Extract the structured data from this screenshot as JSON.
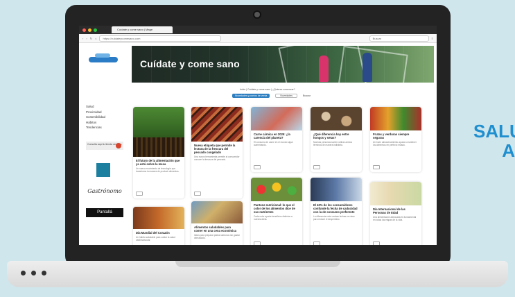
{
  "side_text": {
    "line1": "SALU",
    "line2": "A"
  },
  "browser": {
    "tab_title": "Cuídate y come sano | Mage",
    "url": "https://cuidateycomesano.com",
    "search_placeholder": "Buscar"
  },
  "sidebar": {
    "logo_text": "CLL",
    "items": [
      {
        "label": "Salud"
      },
      {
        "label": "Proximidad"
      },
      {
        "label": "Sostenibilidad"
      },
      {
        "label": "Hábitos"
      },
      {
        "label": "Tendencias"
      }
    ],
    "promo1": "Consulta aquí tu tienda cercana",
    "promo3": "Gastrónomo",
    "promo4": "Pantallá"
  },
  "hero": {
    "title": "Cuídate y come sano"
  },
  "breadcrumb": "Inicio | Cuídate y come sano | ¿Quieres comenzar?",
  "filters": {
    "active": "Novedades y puntos de venta",
    "sort": "Novedades",
    "search": "Buscar"
  },
  "cards": [
    {
      "title": "El futuro de la alimentación que ya está sobre la mesa",
      "desc": "Un nuevo movimiento de tecnología que transforma la manera de producir alimentos."
    },
    {
      "title": "Nueva etiqueta que permite la lectura de la frescura del pescado congelado",
      "desc": "Una nueva herramienta permite al consumidor conocer la frescura del pescado."
    },
    {
      "title": "Carne cárnica en 2025: ¿la carencia del planeta?",
      "desc": "El consumo de carne en el mundo sigue aumentando."
    },
    {
      "title": "¿Qué diferencia hay entre hongos y setas?",
      "desc": "Muchas personas suelen utilizar ambos términos de manera indistinta."
    },
    {
      "title": "Frutas y verduras siempre seguras",
      "desc": "Un buen almacenamiento ayuda a mantener los alimentos en perfecto estado."
    },
    {
      "title": "Día Mundial del Corazón",
      "desc": "Un hábito saludable para cuidar la salud cardiovascular."
    },
    {
      "title": "Alimentos saludables para comer en una cena económica",
      "desc": "Ideas para preparar platos sabrosos sin gastar demasiado."
    },
    {
      "title": "Pantone nutricional: lo que el color de los alimentos dice de sus nutrientes",
      "desc": "Cada color aporta beneficios distintos a nuestra dieta."
    },
    {
      "title": "El 40% de los consumidores confunde la fecha de caducidad con la de consumo preferente",
      "desc": "La diferencia entre ambas fechas es clave para reducir el desperdicio."
    },
    {
      "title": "Día Internacional de las Personas de Edad",
      "desc": "Una alimentación adecuada es fundamental en todas las etapas de la vida."
    }
  ]
}
